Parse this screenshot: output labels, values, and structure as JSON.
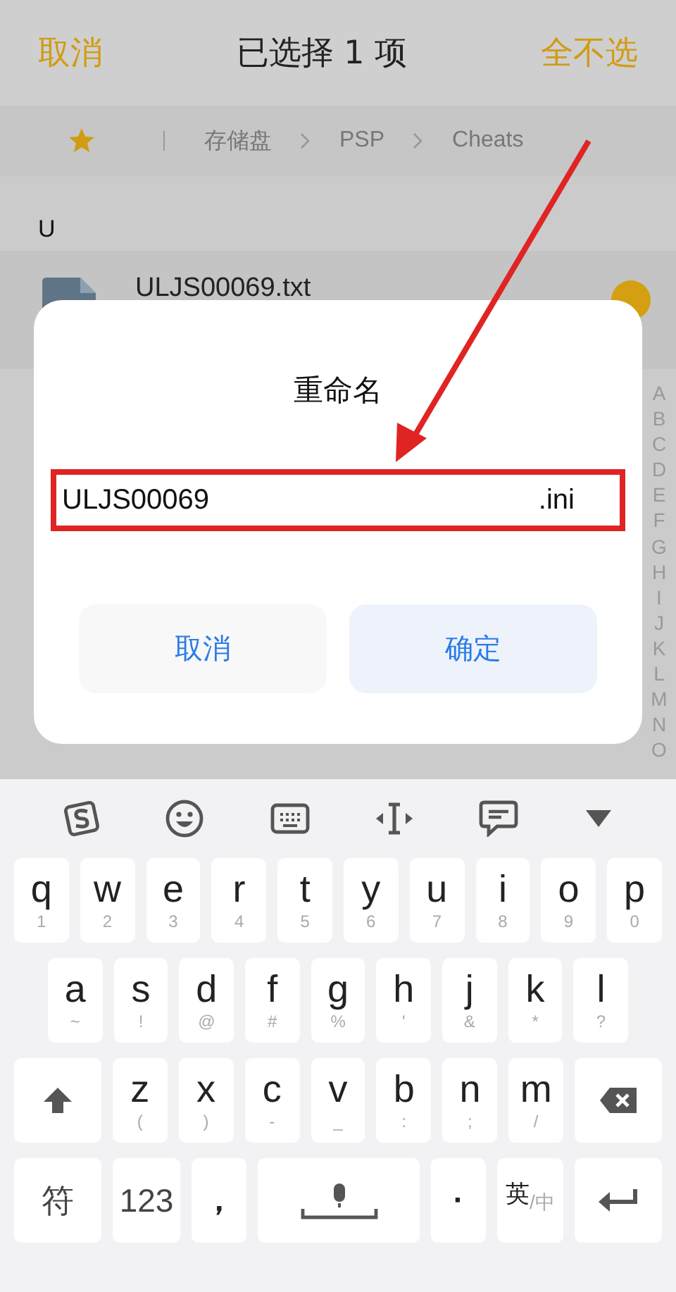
{
  "header": {
    "cancel": "取消",
    "title": "已选择 1 项",
    "deselect_all": "全不选"
  },
  "breadcrumb": {
    "items": [
      "存储盘",
      "PSP",
      "Cheats"
    ]
  },
  "section_label": "U",
  "files": [
    {
      "name": "ULJS00069.txt",
      "selected": true
    }
  ],
  "index_letters": [
    "A",
    "B",
    "C",
    "D",
    "E",
    "F",
    "G",
    "H",
    "I",
    "J",
    "K",
    "L",
    "M",
    "N",
    "O"
  ],
  "dialog": {
    "title": "重命名",
    "field": {
      "name": "ULJS00069",
      "extension": ".ini"
    },
    "buttons": [
      {
        "label": "取消",
        "kind": "cancel"
      },
      {
        "label": "确定",
        "kind": "confirm"
      }
    ]
  },
  "keyboard": {
    "rows": [
      {
        "keys": [
          {
            "kind": "letter",
            "label": "q",
            "hint": "1"
          },
          {
            "kind": "letter",
            "label": "w",
            "hint": "2"
          },
          {
            "kind": "letter",
            "label": "e",
            "hint": "3"
          },
          {
            "kind": "letter",
            "label": "r",
            "hint": "4"
          },
          {
            "kind": "letter",
            "label": "t",
            "hint": "5"
          },
          {
            "kind": "letter",
            "label": "y",
            "hint": "6"
          },
          {
            "kind": "letter",
            "label": "u",
            "hint": "7"
          },
          {
            "kind": "letter",
            "label": "i",
            "hint": "8"
          },
          {
            "kind": "letter",
            "label": "o",
            "hint": "9"
          },
          {
            "kind": "letter",
            "label": "p",
            "hint": "0"
          }
        ]
      },
      {
        "keys": [
          {
            "kind": "letter",
            "label": "a",
            "hint": "~"
          },
          {
            "kind": "letter",
            "label": "s",
            "hint": "!"
          },
          {
            "kind": "letter",
            "label": "d",
            "hint": "@"
          },
          {
            "kind": "letter",
            "label": "f",
            "hint": "#"
          },
          {
            "kind": "letter",
            "label": "g",
            "hint": "%"
          },
          {
            "kind": "letter",
            "label": "h",
            "hint": "'"
          },
          {
            "kind": "letter",
            "label": "j",
            "hint": "&"
          },
          {
            "kind": "letter",
            "label": "k",
            "hint": "*"
          },
          {
            "kind": "letter",
            "label": "l",
            "hint": "?"
          }
        ]
      },
      {
        "keys": [
          {
            "kind": "shift"
          },
          {
            "kind": "letter",
            "label": "z",
            "hint": "("
          },
          {
            "kind": "letter",
            "label": "x",
            "hint": ")"
          },
          {
            "kind": "letter",
            "label": "c",
            "hint": "-"
          },
          {
            "kind": "letter",
            "label": "v",
            "hint": "_"
          },
          {
            "kind": "letter",
            "label": "b",
            "hint": ":"
          },
          {
            "kind": "letter",
            "label": "n",
            "hint": ";"
          },
          {
            "kind": "letter",
            "label": "m",
            "hint": "/"
          },
          {
            "kind": "backspace"
          }
        ]
      },
      {
        "keys": [
          {
            "kind": "symbol",
            "label": "符"
          },
          {
            "kind": "numbers",
            "label": "123"
          },
          {
            "kind": "comma",
            "label": "，"
          },
          {
            "kind": "space"
          },
          {
            "kind": "period",
            "label": "·"
          },
          {
            "kind": "lang",
            "label": "英",
            "hint": "/中"
          },
          {
            "kind": "enter"
          }
        ]
      }
    ]
  }
}
